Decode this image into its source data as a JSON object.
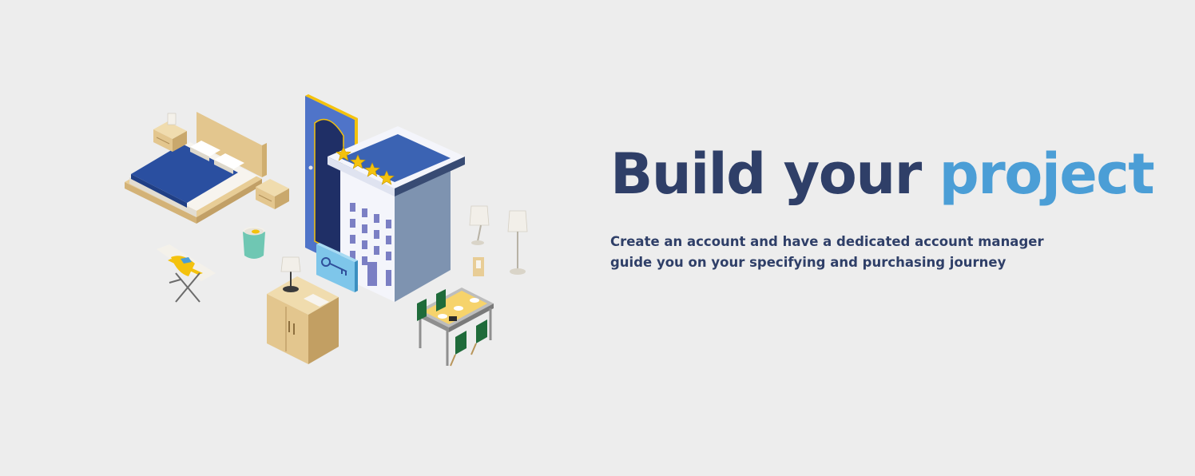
{
  "hero": {
    "headline_part1": "Build your",
    "headline_part2": "project",
    "description": "Create an account and have a dedicated account manager guide you on your specifying and purchasing journey"
  },
  "colors": {
    "background": "#ededed",
    "navy": "#2f3f68",
    "accent_blue": "#4b9ed6",
    "bed_blue": "#2a4fa0",
    "wood": "#e8cd96",
    "building_light": "#f4f5fb",
    "building_shade": "#7e93b0",
    "window": "#7b7fc4",
    "door_blue": "#4f74c9",
    "gold": "#f4c20d",
    "chair_green": "#1f6b3a",
    "bin_teal": "#6fc7b3",
    "key_sign": "#7ec6ea"
  },
  "illustration": {
    "star_count": 4,
    "items": [
      "bed-icon",
      "nightstand-icon",
      "hotel-building-icon",
      "door-icon",
      "key-sign-icon",
      "floor-lamp-icon",
      "table-lamp-icon",
      "dresser-icon",
      "dining-table-icon",
      "ironing-board-icon",
      "waste-bin-icon"
    ]
  }
}
